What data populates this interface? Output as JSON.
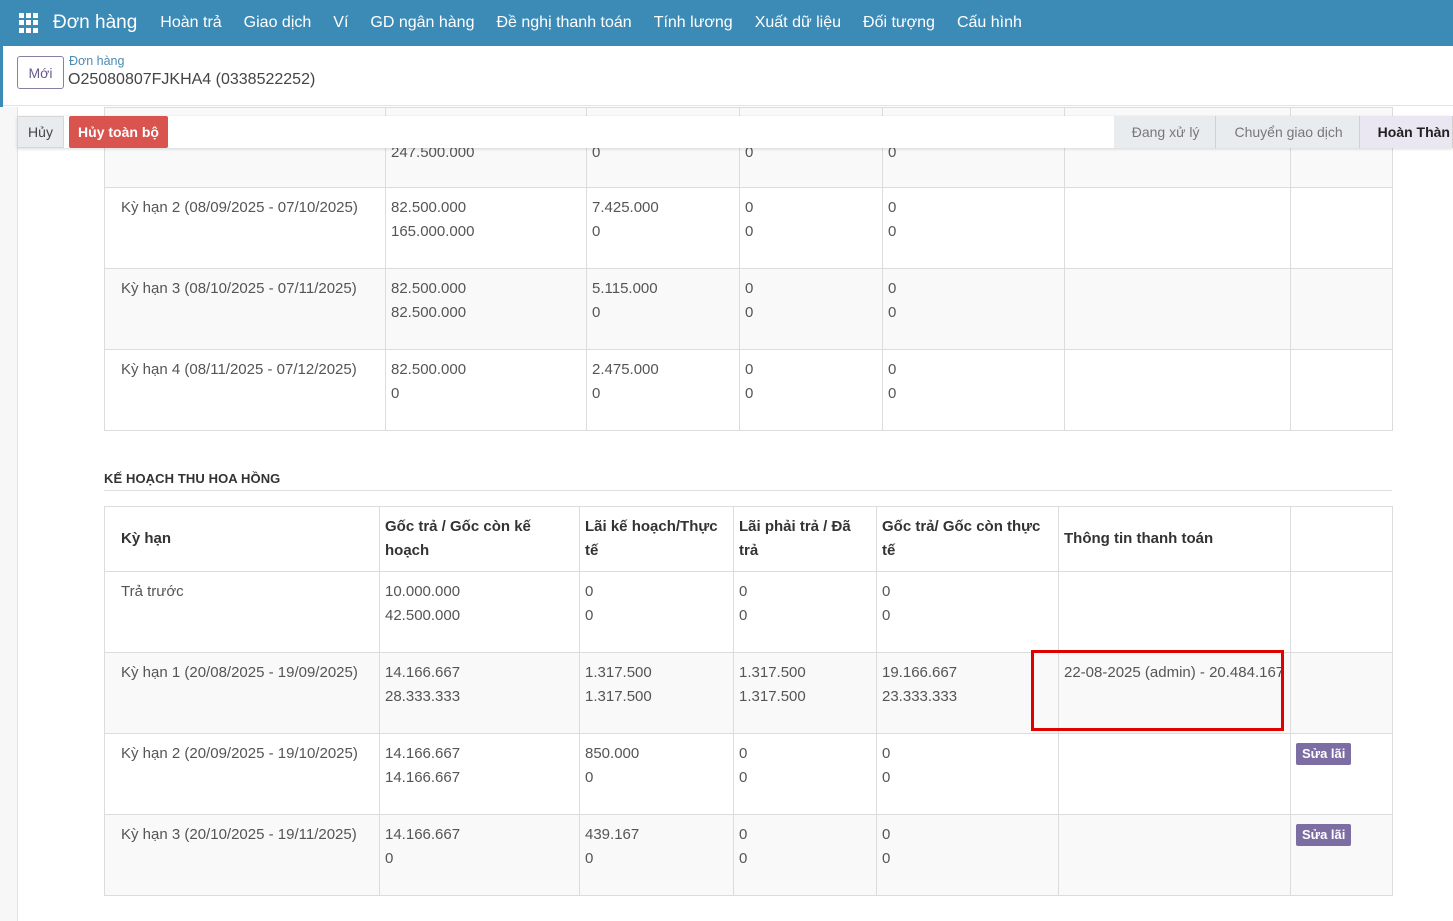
{
  "navbar": {
    "brand": "Đơn hàng",
    "menu": [
      "Hoàn trả",
      "Giao dịch",
      "Ví",
      "GD ngân hàng",
      "Đề nghị thanh toán",
      "Tính lương",
      "Xuất dữ liệu",
      "Đối tượng",
      "Cấu hình"
    ]
  },
  "control": {
    "new_label": "Mới",
    "breadcrumb_parent": "Đơn hàng",
    "breadcrumb_current": "O25080807FJKHA4 (0338522252)"
  },
  "actions": {
    "cancel_label": "Hủy",
    "cancel_all_label": "Hủy toàn bộ",
    "stages": [
      "Đang xử lý",
      "Chuyển giao dịch",
      "Hoàn Thàn"
    ]
  },
  "upper_table": {
    "rows": [
      {
        "term": "",
        "c1": [
          "247.500.000"
        ],
        "c2": [
          "0"
        ],
        "c3": [
          "0"
        ],
        "c4": [
          "0"
        ],
        "partial": true
      },
      {
        "term": "Kỳ hạn 2 (08/09/2025 - 07/10/2025)",
        "c1": [
          "82.500.000",
          "165.000.000"
        ],
        "c2": [
          "7.425.000",
          "0"
        ],
        "c3": [
          "0",
          "0"
        ],
        "c4": [
          "0",
          "0"
        ]
      },
      {
        "term": "Kỳ hạn 3 (08/10/2025 - 07/11/2025)",
        "c1": [
          "82.500.000",
          "82.500.000"
        ],
        "c2": [
          "5.115.000",
          "0"
        ],
        "c3": [
          "0",
          "0"
        ],
        "c4": [
          "0",
          "0"
        ]
      },
      {
        "term": "Kỳ hạn 4 (08/11/2025 - 07/12/2025)",
        "c1": [
          "82.500.000",
          "0"
        ],
        "c2": [
          "2.475.000",
          "0"
        ],
        "c3": [
          "0",
          "0"
        ],
        "c4": [
          "0",
          "0"
        ]
      }
    ]
  },
  "commission": {
    "title": "KẾ HOẠCH THU HOA HỒNG",
    "headers": [
      "Kỳ hạn",
      "Gốc trả / Gốc còn kế hoạch",
      "Lãi kế hoạch/Thực tế",
      "Lãi phải trả / Đã trả",
      "Gốc trả/ Gốc còn thực tế",
      "Thông tin thanh toán",
      ""
    ],
    "rows": [
      {
        "term": "Trả trước",
        "c1": [
          "10.000.000",
          "42.500.000"
        ],
        "c2": [
          "0",
          "0"
        ],
        "c3": [
          "0",
          "0"
        ],
        "c4": [
          "0",
          "0"
        ],
        "payment": "",
        "action": ""
      },
      {
        "term": "Kỳ hạn 1 (20/08/2025 - 19/09/2025)",
        "c1": [
          "14.166.667",
          "28.333.333"
        ],
        "c2": [
          "1.317.500",
          "1.317.500"
        ],
        "c3": [
          "1.317.500",
          "1.317.500"
        ],
        "c4": [
          "19.166.667",
          "23.333.333"
        ],
        "payment": "22-08-2025 (admin) - 20.484.167",
        "action": ""
      },
      {
        "term": "Kỳ hạn 2 (20/09/2025 - 19/10/2025)",
        "c1": [
          "14.166.667",
          "14.166.667"
        ],
        "c2": [
          "850.000",
          "0"
        ],
        "c3": [
          "0",
          "0"
        ],
        "c4": [
          "0",
          "0"
        ],
        "payment": "",
        "action": "Sửa lãi"
      },
      {
        "term": "Kỳ hạn 3 (20/10/2025 - 19/11/2025)",
        "c1": [
          "14.166.667",
          "0"
        ],
        "c2": [
          "439.167",
          "0"
        ],
        "c3": [
          "0",
          "0"
        ],
        "c4": [
          "0",
          "0"
        ],
        "payment": "",
        "action": "Sửa lãi"
      }
    ]
  }
}
